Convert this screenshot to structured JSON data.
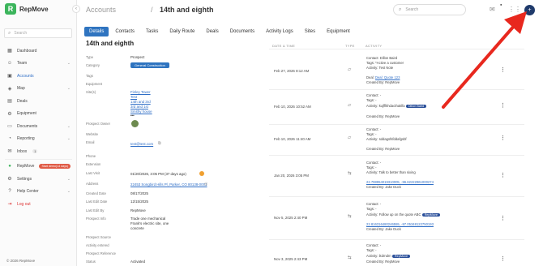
{
  "app": {
    "name": "RepMove",
    "logo_letter": "R"
  },
  "sidebar": {
    "search_placeholder": "Search",
    "items": [
      {
        "label": "Dashboard",
        "icon": "grid-icon"
      },
      {
        "label": "Team",
        "icon": "team-icon"
      },
      {
        "label": "Accounts",
        "icon": "accounts-icon"
      },
      {
        "label": "Map",
        "icon": "map-icon"
      },
      {
        "label": "Deals",
        "icon": "deals-icon"
      },
      {
        "label": "Equipment",
        "icon": "equipment-icon"
      },
      {
        "label": "Documents",
        "icon": "documents-icon"
      },
      {
        "label": "Reporting",
        "icon": "reporting-icon"
      },
      {
        "label": "Inbox",
        "icon": "inbox-icon",
        "badge": "1"
      },
      {
        "label": "RepMove",
        "icon": "repmove-icon",
        "button": "Start demo(14 days)"
      },
      {
        "label": "Settings",
        "icon": "gear-icon"
      },
      {
        "label": "Help Center",
        "icon": "help-icon"
      },
      {
        "label": "Log out",
        "icon": "logout-icon"
      }
    ],
    "copyright": "© 2026 RepMove"
  },
  "header": {
    "breadcrumb": "Accounts",
    "separator": "/",
    "title": "14th and eighth",
    "search_placeholder": "Search",
    "notif_dot": "●"
  },
  "tabs": [
    "Details",
    "Contacts",
    "Tasks",
    "Daily Route",
    "Deals",
    "Documents",
    "Activity Logs",
    "Sites",
    "Equipment"
  ],
  "details": {
    "title": "14th and eighth",
    "fields": [
      {
        "label": "Type",
        "value": "Prospect"
      },
      {
        "label": "Category",
        "badge": "General Construction"
      },
      {
        "label": "Tags",
        "value": ""
      },
      {
        "label": "Equipment",
        "value": ""
      },
      {
        "label": "Site(s)",
        "links": [
          "Finley Tower",
          "Test",
          "14th and 3rd",
          "3rd and 1st",
          "Smithy house"
        ],
        "more": "•••"
      },
      {
        "label": "Prospect Owner",
        "value": ""
      },
      {
        "label": "Website",
        "value": ""
      },
      {
        "label": "Email",
        "link": "test@test.com"
      },
      {
        "label": "Phone",
        "value": ""
      },
      {
        "label": "Extension",
        "value": ""
      },
      {
        "label": "Last Visit",
        "value": "01/20/2026, 3:05 PM (37 days ago)"
      },
      {
        "label": "Address",
        "link": "22453 Songbird Hills Pl, Parker, CO 80138-0001"
      },
      {
        "label": "Created Date",
        "value": "08/17/2025"
      },
      {
        "label": "Last Edit Date",
        "value": "12/15/2025"
      },
      {
        "label": "Last Edit By",
        "value": "RepMove"
      },
      {
        "label": "Prospect Info",
        "value": "Trade one mechanical Frank's electric site, one concrete"
      },
      {
        "label": "Prospect Source",
        "value": ""
      },
      {
        "label": "Activity entered",
        "value": ""
      },
      {
        "label": "Prospect Reference",
        "value": ""
      },
      {
        "label": "Status",
        "value": "Activated"
      }
    ]
  },
  "activity": {
    "headers": {
      "date": "DATE & TIME",
      "type": "TYPE",
      "activity": "ACTIVITY"
    },
    "rows": [
      {
        "date": "Feb 27, 2026 8:12 AM",
        "type_icon": "note-icon",
        "lines": [
          "Contact: Dillon Baird",
          "Tags: *Active a customer",
          "Activity: Test Note",
          "",
          "Deal: Quote 123",
          "Created By: RepMove"
        ],
        "link_line": 4
      },
      {
        "date": "Feb 10, 2026 10:52 AM",
        "type_icon": "note-icon",
        "lines": [
          "Contact: -",
          "Tags: -",
          "Activity: kujfflkhdacthaklfa",
          "",
          "Created By: RepMove"
        ],
        "pill": "Dillon Baird"
      },
      {
        "date": "Feb 10, 2026 11:40 AM",
        "type_icon": "note-icon",
        "lines": [
          "Contact: -",
          "Tags: -",
          "Activity: sddagsfsfddafgsbf",
          "",
          "Created By: RepMove"
        ]
      },
      {
        "date": "Jan 20, 2026 3:05 PM",
        "type_icon": "visit-icon",
        "lines": [
          "Contact: -",
          "Tags: -",
          "Activity: Talk to better than sixing",
          "",
          "22.798954019310005, -96.62222961000274",
          "Created By: Jake Duck"
        ],
        "link_line": 4
      },
      {
        "date": "Nov 5, 2025 2:40 PM",
        "type_icon": "visit-icon",
        "lines": [
          "Contact: -",
          "Tags: -",
          "Activity: Follow up on the quote ABC",
          "",
          "22.816316480246555, -97.05348122750193",
          "Created By: Jake Duck"
        ],
        "link_line": 4,
        "pill": "RepMove"
      },
      {
        "date": "Nov 3, 2025 2:43 PM",
        "type_icon": "visit-icon",
        "lines": [
          "Contact: -",
          "Tags: -",
          "Activity: ikdrndrn",
          "Created By: RepMove"
        ],
        "pill": "RepMove"
      }
    ]
  }
}
